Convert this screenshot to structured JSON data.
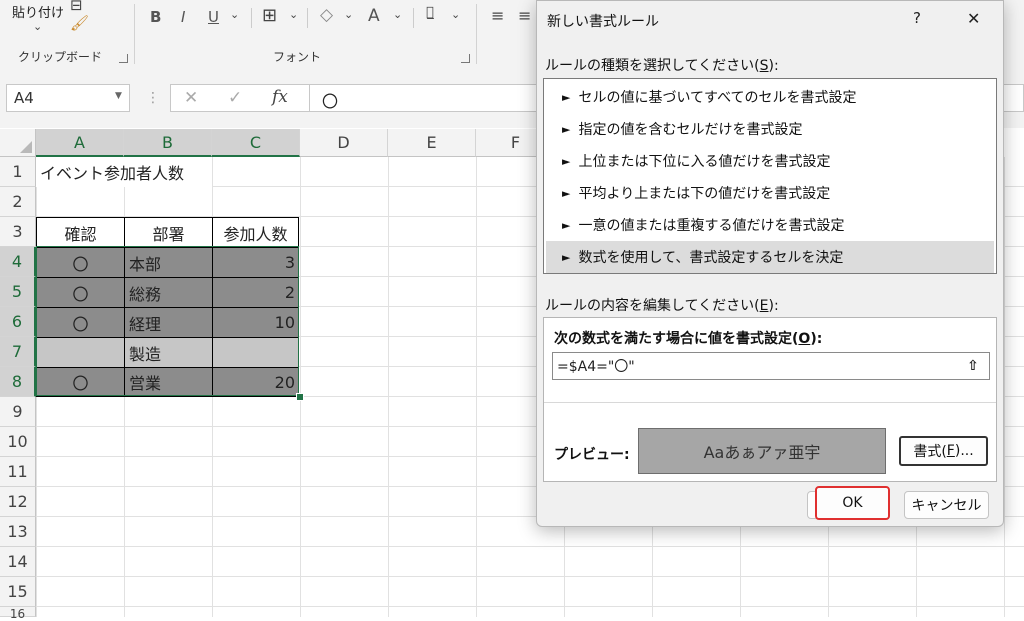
{
  "ribbon": {
    "paste_label": "貼り付け",
    "clipboard_group": "クリップボード",
    "font_group": "フォント",
    "bold": "B",
    "italic": "I",
    "underline": "U",
    "font_color_letter": "A"
  },
  "formula_bar": {
    "name_box": "A4",
    "fx_label": "fx",
    "content": "〇"
  },
  "sheet": {
    "columns": [
      "A",
      "B",
      "C",
      "D",
      "E",
      "F"
    ],
    "rows": [
      "1",
      "2",
      "3",
      "4",
      "5",
      "6",
      "7",
      "8",
      "9",
      "10",
      "11",
      "12",
      "13",
      "14",
      "15",
      "16"
    ],
    "title": "イベント参加者人数",
    "headers": [
      "確認",
      "部署",
      "参加人数"
    ],
    "data": [
      {
        "check": "〇",
        "dept": "本部",
        "count": "3"
      },
      {
        "check": "〇",
        "dept": "総務",
        "count": "2"
      },
      {
        "check": "〇",
        "dept": "経理",
        "count": "10"
      },
      {
        "check": "",
        "dept": "製造",
        "count": ""
      },
      {
        "check": "〇",
        "dept": "営業",
        "count": "20"
      }
    ]
  },
  "dialog": {
    "title": "新しい書式ルール",
    "help": "?",
    "close": "✕",
    "rule_type_label": "ルールの種類を選択してください(",
    "rule_type_key": "S",
    "rule_type_end": "):",
    "rule_types": [
      "セルの値に基づいてすべてのセルを書式設定",
      "指定の値を含むセルだけを書式設定",
      "上位または下位に入る値だけを書式設定",
      "平均より上または下の値だけを書式設定",
      "一意の値または重複する値だけを書式設定",
      "数式を使用して、書式設定するセルを決定"
    ],
    "selected_rule_index": 5,
    "edit_label": "ルールの内容を編集してください(",
    "edit_key": "E",
    "edit_end": "):",
    "formula_label": "次の数式を満たす場合に値を書式設定(",
    "formula_key": "O",
    "formula_end": "):",
    "formula_value": "=$A4=\"〇\"",
    "preview_label": "プレビュー:",
    "preview_text": "Aaあぁアァ亜宇",
    "format_button": "書式(",
    "format_key": "F",
    "format_end": ")...",
    "ok": "OK",
    "cancel": "キャンセル"
  },
  "colors": {
    "excel_green": "#217346",
    "ok_highlight": "#e03030",
    "dark_fill": "#8c8c8c",
    "light_fill": "#c6c6c6"
  }
}
